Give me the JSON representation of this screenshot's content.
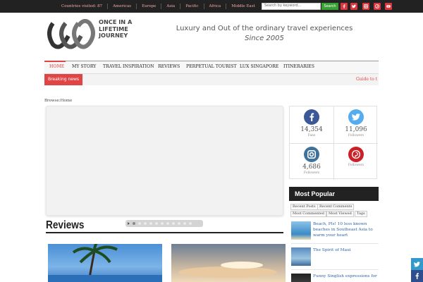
{
  "topbar": {
    "nav": [
      "Countries visited: 87",
      "Americas",
      "Europe",
      "Asia",
      "Pacific",
      "Africa",
      "Middle East"
    ],
    "search_placeholder": "Search by keyword...",
    "search_button": "Search",
    "social_icons": [
      "facebook-icon",
      "twitter-icon",
      "instagram-icon",
      "pinterest-icon",
      "youtube-icon"
    ]
  },
  "header": {
    "logo_lines": [
      "ONCE IN A",
      "LIFETIME",
      "JOURNEY"
    ],
    "tagline": "Luxury and Out of the ordinary travel experiences",
    "tagline_sub": "Since 2005"
  },
  "mainnav": {
    "items": [
      "HOME",
      "MY STORY",
      "TRAVEL INSPIRATION",
      "REVIEWS",
      "PERPETUAL TOURIST",
      "LUX SINGAPORE",
      "ITINERARIES"
    ]
  },
  "breaking": {
    "label": "Breaking news",
    "ticker": "Guide to t"
  },
  "breadcrumb": "Browse:Home",
  "reviews": {
    "title": "Reviews"
  },
  "social_counters": [
    {
      "icon": "facebook-icon",
      "count": "14,354",
      "label": "Fans",
      "color": "#3b5998"
    },
    {
      "icon": "twitter-icon",
      "count": "11,096",
      "label": "Followers",
      "color": "#55acee"
    },
    {
      "icon": "instagram-icon",
      "count": "4,686",
      "label": "Followers",
      "color": "#3f729b"
    },
    {
      "icon": "pinterest-icon",
      "count": "",
      "label": "Followers",
      "color": "#cb2027"
    }
  ],
  "popular": {
    "title": "Most Popular",
    "tabs": [
      "Recent Posts",
      "Recent Comments",
      "Most Commented",
      "Most Viewed",
      "Tags"
    ],
    "items": [
      "Beach, Pls! 10 less known beaches in Southeast Asia to warm your heart",
      "The Spirit of Maui",
      "Funny Singlish expressions for"
    ]
  },
  "colors": {
    "accent": "#e04545",
    "dark": "#222222",
    "green": "#3aa035"
  }
}
